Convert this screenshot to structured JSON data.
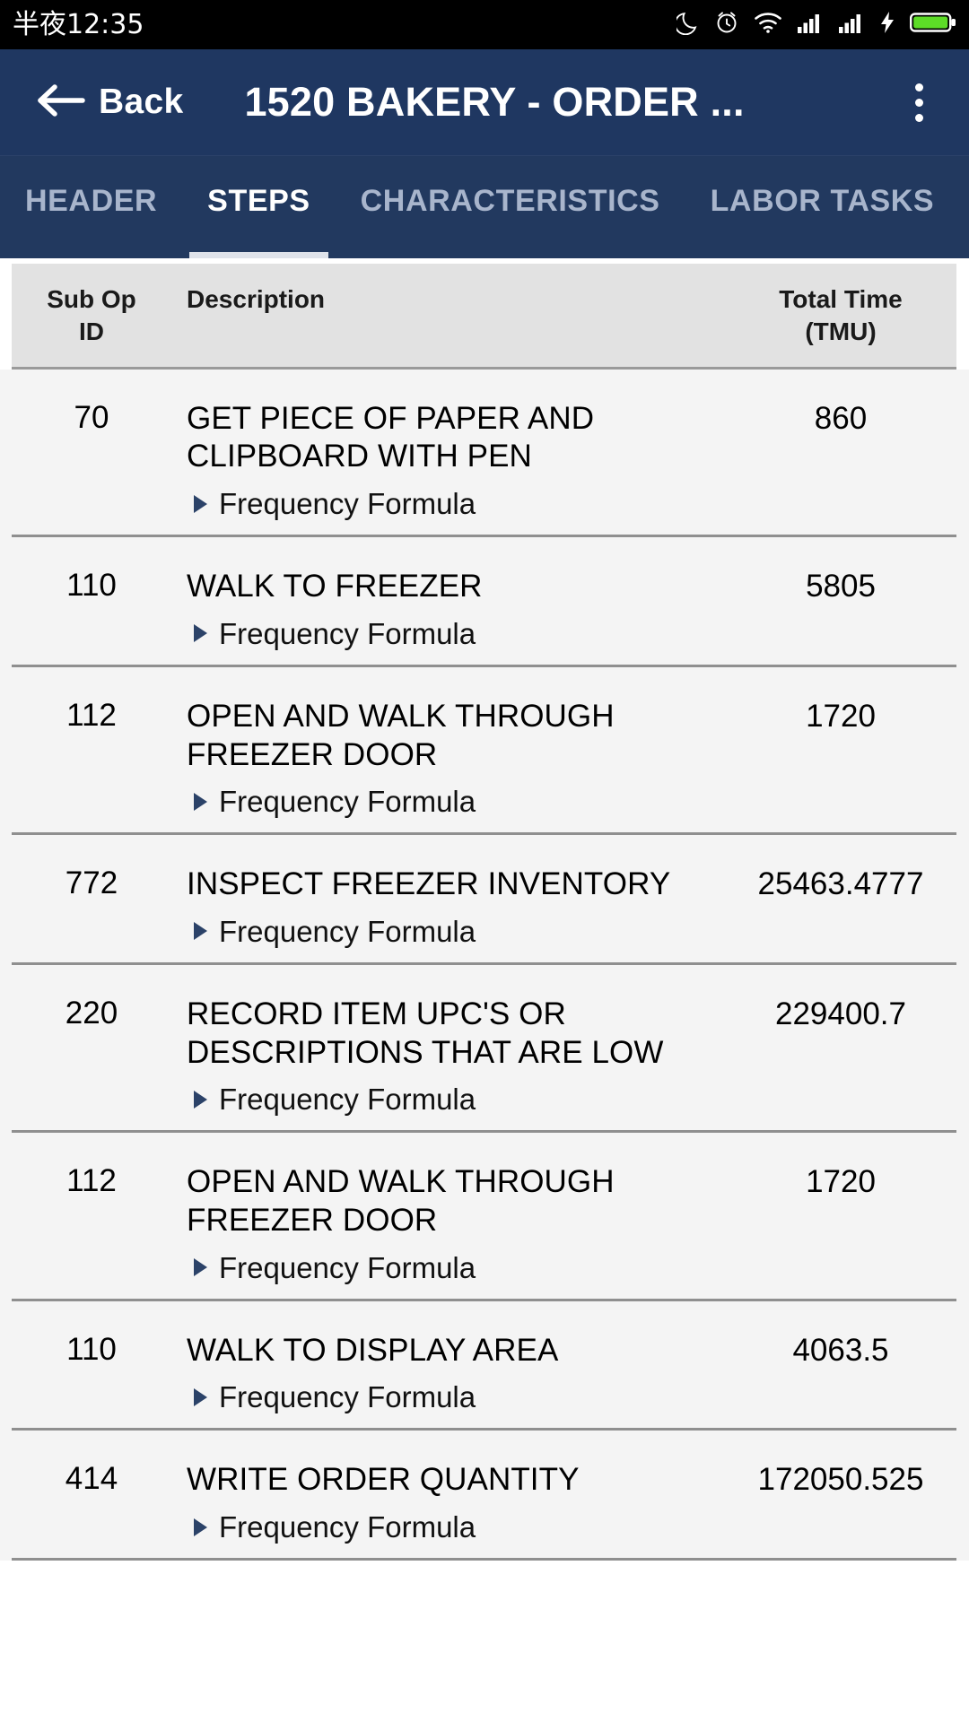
{
  "statusbar": {
    "time": "半夜12:35",
    "icons": [
      "moon-icon",
      "alarm-icon",
      "wifi-icon",
      "signal-1-icon",
      "signal-2-icon",
      "charging-bolt-icon",
      "battery-icon"
    ]
  },
  "appbar": {
    "back_label": "Back",
    "back_icon": "back-arrow-icon",
    "title": "1520  BAKERY - ORDER ...",
    "overflow_icon": "overflow-menu-icon",
    "color": "#1f3761"
  },
  "tabs": [
    {
      "label": "HEADER",
      "active": false
    },
    {
      "label": "STEPS",
      "active": true
    },
    {
      "label": "CHARACTERISTICS",
      "active": false
    },
    {
      "label": "LABOR TASKS",
      "active": false
    }
  ],
  "table": {
    "headers": {
      "sub_op_id": "Sub Op\nID",
      "sub_op_id_line1": "Sub Op",
      "sub_op_id_line2": "ID",
      "description": "Description",
      "total_time_line1": "Total Time",
      "total_time_line2": "(TMU)"
    },
    "expand_label": "Frequency Formula",
    "rows": [
      {
        "sub_op_id": "70",
        "description": "GET PIECE OF PAPER AND CLIPBOARD WITH PEN",
        "total_time": "860",
        "formula_label": "Frequency Formula"
      },
      {
        "sub_op_id": "110",
        "description": "WALK TO FREEZER",
        "total_time": "5805",
        "formula_label": "Frequency Formula"
      },
      {
        "sub_op_id": "112",
        "description": "OPEN AND WALK THROUGH FREEZER DOOR",
        "total_time": "1720",
        "formula_label": "Frequency Formula"
      },
      {
        "sub_op_id": "772",
        "description": "INSPECT FREEZER INVENTORY",
        "total_time": "25463.4777",
        "formula_label": "Frequency Formula"
      },
      {
        "sub_op_id": "220",
        "description": "RECORD ITEM UPC'S OR DESCRIPTIONS THAT ARE LOW",
        "total_time": "229400.7",
        "formula_label": "Frequency Formula"
      },
      {
        "sub_op_id": "112",
        "description": "OPEN AND WALK THROUGH FREEZER DOOR",
        "total_time": "1720",
        "formula_label": "Frequency Formula"
      },
      {
        "sub_op_id": "110",
        "description": "WALK TO DISPLAY AREA",
        "total_time": "4063.5",
        "formula_label": "Frequency Formula"
      },
      {
        "sub_op_id": "414",
        "description": "WRITE ORDER QUANTITY",
        "total_time": "172050.525",
        "formula_label": "Frequency Formula"
      }
    ]
  },
  "colors": {
    "appbar": "#1f3761",
    "tabbar": "#22395f",
    "tab_active_indicator": "#dfe3ea",
    "tab_inactive_text": "#a8b5cc",
    "header_row_bg": "#e2e2e2",
    "list_bg": "#f4f4f4",
    "divider": "#8f8f8f",
    "triangle": "#2b4268",
    "battery": "#5ddc27"
  }
}
